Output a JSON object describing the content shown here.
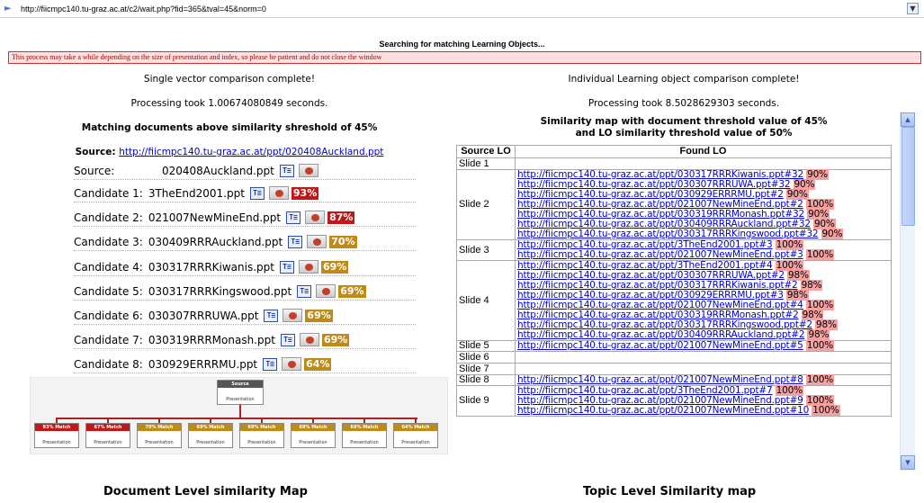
{
  "address": {
    "url": "http://fiicmpc140.tu-graz.ac.at/c2/wait.php?fid=365&tval=45&norm=0"
  },
  "status": {
    "searching": "Searching for matching Learning Objects...",
    "warning": "This process may take a while depending on the size of presentation and index, so please be patient and do not close the window"
  },
  "left": {
    "complete": "Single vector comparison complete!",
    "processing": "Processing took 1.00674080849 seconds.",
    "heading": "Matching documents above similarity shreshold of 45%",
    "source_label": "Source:",
    "source_url": "http://fiicmpc140.tu-graz.ac.at/ppt/020408Auckland.ppt",
    "rows": [
      {
        "label": "Source:",
        "file": "020408Auckland.ppt",
        "pct": "",
        "color": ""
      },
      {
        "label": "Candidate 1:",
        "file": "3TheEnd2001.ppt",
        "pct": "93%",
        "color": "#c01818"
      },
      {
        "label": "Candidate 2:",
        "file": "021007NewMineEnd.ppt",
        "pct": "87%",
        "color": "#c01818"
      },
      {
        "label": "Candidate 3:",
        "file": "030409RRRAuckland.ppt",
        "pct": "70%",
        "color": "#c08a18"
      },
      {
        "label": "Candidate 4:",
        "file": "030317RRRKiwanis.ppt",
        "pct": "69%",
        "color": "#c08a18"
      },
      {
        "label": "Candidate 5:",
        "file": "030317RRRKingswood.ppt",
        "pct": "69%",
        "color": "#c08a18"
      },
      {
        "label": "Candidate 6:",
        "file": "030307RRRUWA.ppt",
        "pct": "69%",
        "color": "#c08a18"
      },
      {
        "label": "Candidate 7:",
        "file": "030319RRRMonash.ppt",
        "pct": "69%",
        "color": "#c08a18"
      },
      {
        "label": "Candidate 8:",
        "file": "030929ERRRMU.ppt",
        "pct": "64%",
        "color": "#c08a18"
      }
    ],
    "tree": {
      "root_title": "Source",
      "root_label": "Presentation",
      "children": [
        {
          "title": "93% Match",
          "label": "Presentation",
          "color": "#c01818"
        },
        {
          "title": "87% Match",
          "label": "Presentation",
          "color": "#c01818"
        },
        {
          "title": "70% Match",
          "label": "Presentation",
          "color": "#c08a18"
        },
        {
          "title": "69% Match",
          "label": "Presentation",
          "color": "#c08a18"
        },
        {
          "title": "69% Match",
          "label": "Presentation",
          "color": "#c08a18"
        },
        {
          "title": "69% Match",
          "label": "Presentation",
          "color": "#c08a18"
        },
        {
          "title": "69% Match",
          "label": "Presentation",
          "color": "#c08a18"
        },
        {
          "title": "64% Match",
          "label": "Presentation",
          "color": "#c08a18"
        }
      ]
    },
    "caption": "Document Level similarity Map"
  },
  "right": {
    "complete": "Individual Learning object comparison complete!",
    "processing": "Processing took 8.5028629303 seconds.",
    "heading_line1": "Similarity map with document threshold value of 45%",
    "heading_line2": "and LO similarity threshold value of 50%",
    "col_source": "Source LO",
    "col_found": "Found LO",
    "rows": [
      {
        "slide": "Slide 1",
        "links": []
      },
      {
        "slide": "Slide 2",
        "links": [
          {
            "url": "http://fiicmpc140.tu-graz.ac.at/ppt/030317RRRKiwanis.ppt#32",
            "pct": "90%"
          },
          {
            "url": "http://fiicmpc140.tu-graz.ac.at/ppt/030307RRRUWA.ppt#32",
            "pct": "90%"
          },
          {
            "url": "http://fiicmpc140.tu-graz.ac.at/ppt/030929ERRRMU.ppt#2",
            "pct": "90%"
          },
          {
            "url": "http://fiicmpc140.tu-graz.ac.at/ppt/021007NewMineEnd.ppt#2",
            "pct": "100%"
          },
          {
            "url": "http://fiicmpc140.tu-graz.ac.at/ppt/030319RRRMonash.ppt#32",
            "pct": "90%"
          },
          {
            "url": "http://fiicmpc140.tu-graz.ac.at/ppt/030409RRRAuckland.ppt#32",
            "pct": "90%"
          },
          {
            "url": "http://fiicmpc140.tu-graz.ac.at/ppt/030317RRRKingswood.ppt#32",
            "pct": "90%"
          }
        ]
      },
      {
        "slide": "Slide 3",
        "links": [
          {
            "url": "http://fiicmpc140.tu-graz.ac.at/ppt/3TheEnd2001.ppt#3",
            "pct": "100%"
          },
          {
            "url": "http://fiicmpc140.tu-graz.ac.at/ppt/021007NewMineEnd.ppt#3",
            "pct": "100%"
          }
        ]
      },
      {
        "slide": "Slide 4",
        "links": [
          {
            "url": "http://fiicmpc140.tu-graz.ac.at/ppt/3TheEnd2001.ppt#4",
            "pct": "100%"
          },
          {
            "url": "http://fiicmpc140.tu-graz.ac.at/ppt/030307RRRUWA.ppt#2",
            "pct": "98%"
          },
          {
            "url": "http://fiicmpc140.tu-graz.ac.at/ppt/030317RRRKiwanis.ppt#2",
            "pct": "98%"
          },
          {
            "url": "http://fiicmpc140.tu-graz.ac.at/ppt/030929ERRRMU.ppt#3",
            "pct": "98%"
          },
          {
            "url": "http://fiicmpc140.tu-graz.ac.at/ppt/021007NewMineEnd.ppt#4",
            "pct": "100%"
          },
          {
            "url": "http://fiicmpc140.tu-graz.ac.at/ppt/030319RRRMonash.ppt#2",
            "pct": "98%"
          },
          {
            "url": "http://fiicmpc140.tu-graz.ac.at/ppt/030317RRRKingswood.ppt#2",
            "pct": "98%"
          },
          {
            "url": "http://fiicmpc140.tu-graz.ac.at/ppt/030409RRRAuckland.ppt#2",
            "pct": "98%"
          }
        ]
      },
      {
        "slide": "Slide 5",
        "links": [
          {
            "url": "http://fiicmpc140.tu-graz.ac.at/ppt/021007NewMineEnd.ppt#5",
            "pct": "100%"
          }
        ]
      },
      {
        "slide": "Slide 6",
        "links": []
      },
      {
        "slide": "Slide 7",
        "links": []
      },
      {
        "slide": "Slide 8",
        "links": [
          {
            "url": "http://fiicmpc140.tu-graz.ac.at/ppt/021007NewMineEnd.ppt#8",
            "pct": "100%"
          }
        ]
      },
      {
        "slide": "Slide 9",
        "links": [
          {
            "url": "http://fiicmpc140.tu-graz.ac.at/ppt/3TheEnd2001.ppt#7",
            "pct": "100%"
          },
          {
            "url": "http://fiicmpc140.tu-graz.ac.at/ppt/021007NewMineEnd.ppt#9",
            "pct": "100%"
          },
          {
            "url": "http://fiicmpc140.tu-graz.ac.at/ppt/021007NewMineEnd.ppt#10",
            "pct": "100%"
          }
        ]
      }
    ],
    "caption": "Topic Level Similarity map"
  },
  "icons": {
    "page": "page-icon",
    "dropdown": "chevron-down-icon",
    "text_view": "text-view-icon",
    "slide_view": "slide-thumbnail-icon",
    "scroll_up": "scroll-up-icon",
    "scroll_down": "scroll-down-icon"
  }
}
